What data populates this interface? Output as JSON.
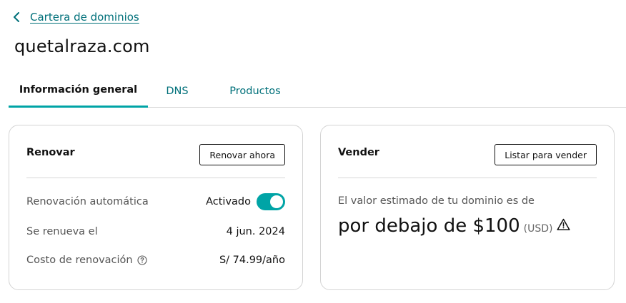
{
  "breadcrumb": {
    "back_label": "Cartera de dominios"
  },
  "page": {
    "title": "quetalraza.com"
  },
  "tabs": [
    {
      "label": "Información general",
      "active": true
    },
    {
      "label": "DNS",
      "active": false
    },
    {
      "label": "Productos",
      "active": false
    }
  ],
  "renew_card": {
    "title": "Renovar",
    "button_label": "Renovar ahora",
    "auto_renew": {
      "label": "Renovación automática",
      "status": "Activado",
      "enabled": true
    },
    "renews_on": {
      "label": "Se renueva el",
      "value": "4 jun. 2024"
    },
    "renewal_cost": {
      "label": "Costo de renovación",
      "value": "S/ 74.99/año"
    }
  },
  "sell_card": {
    "title": "Vender",
    "button_label": "Listar para vender",
    "estimate_text": "El valor estimado de tu dominio es de",
    "estimate_amount": "por debajo de $100",
    "estimate_currency": "(USD)"
  },
  "colors": {
    "accent": "#00a4a6",
    "link": "#00707a",
    "text": "#111111",
    "muted": "#555555"
  },
  "icons": {
    "back": "chevron-left-icon",
    "help": "question-circle-icon",
    "warning": "warning-triangle-icon"
  }
}
